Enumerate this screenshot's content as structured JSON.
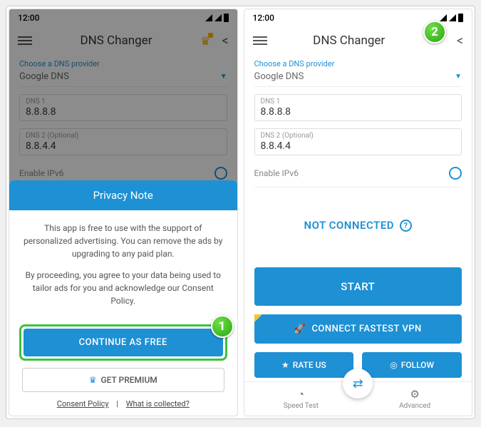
{
  "status": {
    "time": "12:00"
  },
  "header": {
    "title": "DNS Changer"
  },
  "provider": {
    "label": "Choose a DNS provider",
    "value": "Google DNS"
  },
  "dns1": {
    "label": "DNS 1",
    "value": "8.8.8.8"
  },
  "dns2": {
    "label": "DNS 2 (Optional)",
    "value": "8.8.4.4"
  },
  "ipv6": {
    "label": "Enable IPv6"
  },
  "privacy": {
    "title": "Privacy Note",
    "p1": "This app is free to use with the support of personalized advertising. You can remove the ads by upgrading to any paid plan.",
    "p2": "By proceeding, you agree to your data being used to tailor ads for you and acknowledge our Consent Policy.",
    "continue": "CONTINUE AS FREE",
    "premium": "GET PREMIUM",
    "link1": "Consent Policy",
    "sep": "|",
    "link2": "What is collected?"
  },
  "right": {
    "status": "NOT CONNECTED",
    "start": "START",
    "vpn": "CONNECT FASTEST VPN",
    "rate": "RATE US",
    "follow": "FOLLOW",
    "nav1": "Speed Test",
    "nav2": "Advanced"
  },
  "badges": {
    "one": "1",
    "two": "2"
  }
}
